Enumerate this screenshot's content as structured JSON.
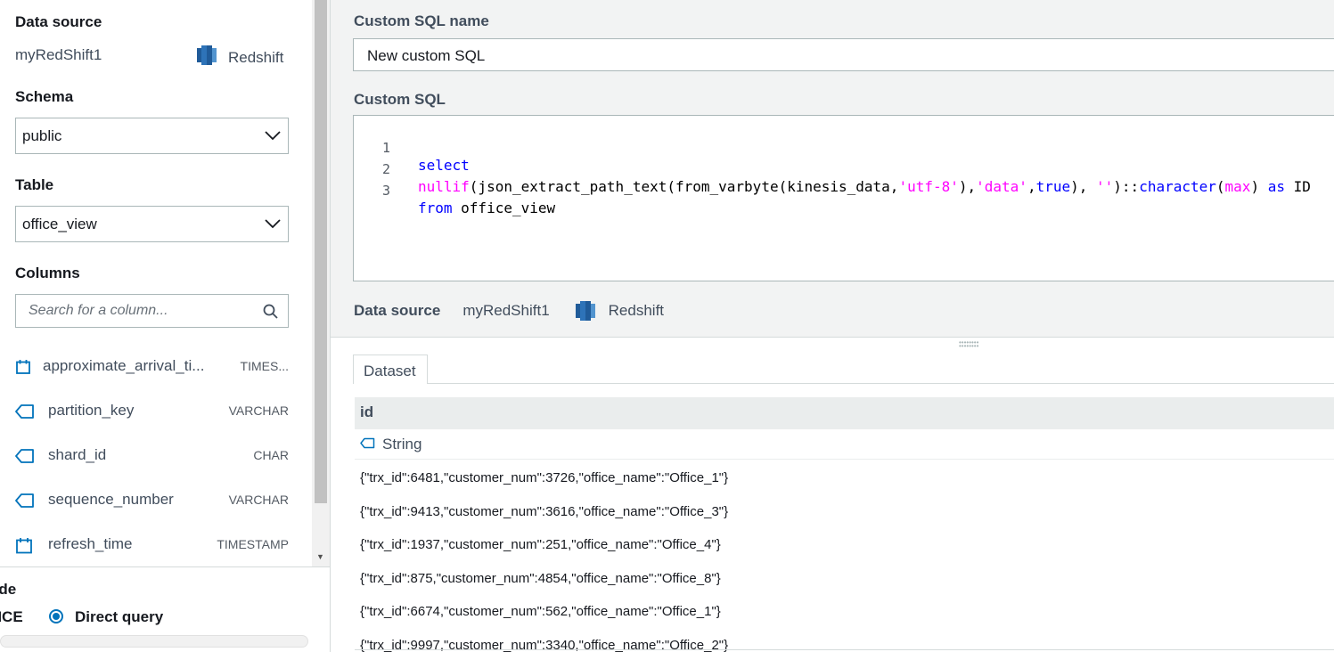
{
  "left": {
    "data_source_label": "Data source",
    "data_source_name": "myRedShift1",
    "data_source_type": "Redshift",
    "schema_label": "Schema",
    "schema_value": "public",
    "table_label": "Table",
    "table_value": "office_view",
    "columns_label": "Columns",
    "search_placeholder": "Search for a column...",
    "columns": [
      {
        "name": "approximate_arrival_ti...",
        "type": "TIMES...",
        "icon": "calendar-icon"
      },
      {
        "name": "partition_key",
        "type": "VARCHAR",
        "icon": "tag-icon"
      },
      {
        "name": "shard_id",
        "type": "CHAR",
        "icon": "tag-icon"
      },
      {
        "name": "sequence_number",
        "type": "VARCHAR",
        "icon": "tag-icon"
      },
      {
        "name": "refresh_time",
        "type": "TIMESTAMP",
        "icon": "calendar-icon"
      }
    ],
    "mode_label": "ode",
    "spice_label": "PICE",
    "direct_query_label": "Direct query"
  },
  "right": {
    "custom_sql_name_label": "Custom SQL name",
    "custom_sql_name_value": "New custom SQL",
    "custom_sql_label": "Custom SQL",
    "sql_line_numbers": [
      "1",
      "2",
      "3"
    ],
    "sql_line1": "select",
    "sql_line2_parts": [
      "nullif",
      "(json_extract_path_text(from_varbyte(kinesis_data,",
      "'utf-8'",
      "),",
      "'data'",
      ",",
      "true",
      "), ",
      "''",
      ")::",
      "character",
      "(",
      "max",
      ") ",
      "as",
      " ID"
    ],
    "sql_line3_parts": [
      "from",
      " office_view"
    ],
    "data_source_label": "Data source",
    "data_source_name": "myRedShift1",
    "data_source_type": "Redshift",
    "tab_label": "Dataset",
    "column_header": "id",
    "column_type": "String",
    "rows": [
      "{\"trx_id\":6481,\"customer_num\":3726,\"office_name\":\"Office_1\"}",
      "{\"trx_id\":9413,\"customer_num\":3616,\"office_name\":\"Office_3\"}",
      "{\"trx_id\":1937,\"customer_num\":251,\"office_name\":\"Office_4\"}",
      "{\"trx_id\":875,\"customer_num\":4854,\"office_name\":\"Office_8\"}",
      "{\"trx_id\":6674,\"customer_num\":562,\"office_name\":\"Office_1\"}",
      "{\"trx_id\":9997,\"customer_num\":3340,\"office_name\":\"Office_2\"}"
    ]
  },
  "colors": {
    "accent": "#0073bb",
    "redshift_blue": "#2e73b8",
    "sql_keyword": "#0000ff",
    "sql_function": "#ff00ff",
    "sql_string": "#a31515"
  }
}
